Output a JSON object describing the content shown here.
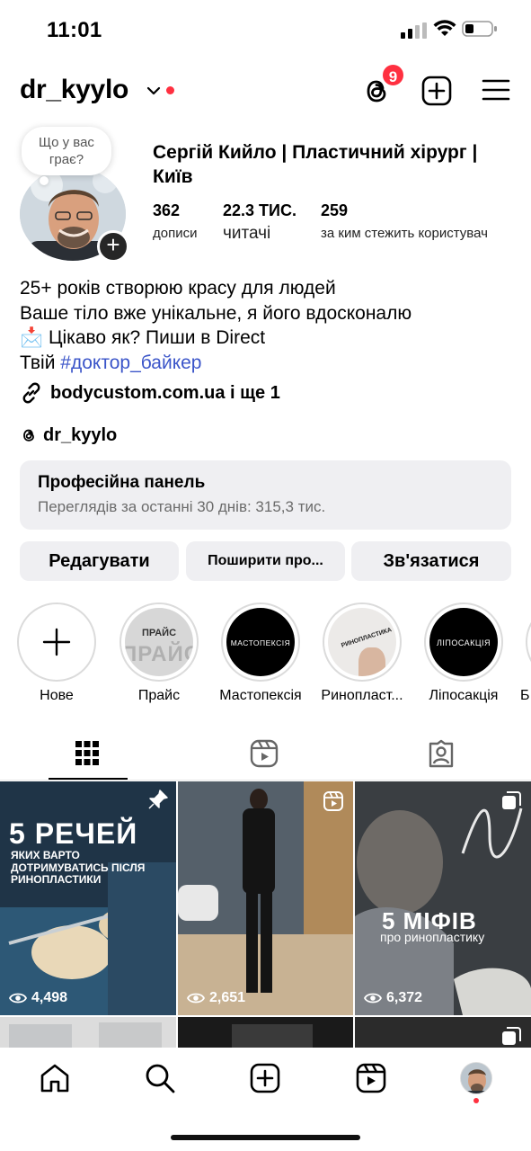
{
  "status_bar": {
    "time": "11:01"
  },
  "header": {
    "username": "dr_kyylo",
    "threads_badge": "9",
    "icons": [
      "chevron-down-icon",
      "threads-icon",
      "plus-square-icon",
      "menu-icon"
    ]
  },
  "profile": {
    "note": "Що у вас граєс?",
    "note_text": "Що у вас грає?",
    "full_name": "Сергій Кийло | Пластичний хірург | Київ",
    "stats": [
      {
        "value": "362",
        "label": "дописи"
      },
      {
        "value": "22.3 ТИС.",
        "label": "читачі"
      },
      {
        "value": "259",
        "label": "за ким стежить користувач"
      }
    ],
    "bio_lines": [
      "25+ років створюю красу для людей",
      "Ваше тіло вже унікальне,  я його вдосконалю",
      "📩 Цікаво як? Пиши в Direct",
      "Твій "
    ],
    "hashtag": "#доктор_байкер",
    "link": "bodycustom.com.ua і ще 1",
    "threads_handle": "dr_kyylo"
  },
  "pro_panel": {
    "title": "Професійна панель",
    "subtitle": "Переглядів за останні 30 днів: 315,3 тис."
  },
  "actions": {
    "edit": "Редагувати",
    "share": "Поширити про...",
    "contact": "Зв'язатися"
  },
  "highlights": [
    {
      "label": "Нове",
      "inner_text": ""
    },
    {
      "label": "Прайс",
      "inner_text": "ПРАЙС"
    },
    {
      "label": "Мастопексія",
      "inner_text": "МАСТОПЕКСІЯ"
    },
    {
      "label": "Ринопласт...",
      "inner_text": "РИНОПЛАСТИКА"
    },
    {
      "label": "Ліпосакція",
      "inner_text": "ЛІПОСАКЦІЯ"
    },
    {
      "label": "Б",
      "inner_text": ""
    }
  ],
  "grid": {
    "tiles": [
      {
        "views": "4,498",
        "headline": "5 РЕЧЕЙ",
        "sub": "ЯКИХ ВАРТО ДОТРИМУВАТИСЬ ПІСЛЯ РИНОПЛАСТИКИ",
        "corner_icon": "pin-icon"
      },
      {
        "views": "2,651",
        "headline": "",
        "sub": "",
        "corner_icon": "reels-icon"
      },
      {
        "views": "6,372",
        "headline": "5 МІФІВ",
        "sub": "про ринопластику",
        "corner_icon": "carousel-icon"
      }
    ]
  },
  "bottom_nav": [
    "home-icon",
    "search-icon",
    "create-icon",
    "reels-icon",
    "profile-avatar"
  ],
  "colors": {
    "accent_red": "#ff3040",
    "hashtag_blue": "#3b55c9",
    "panel_gray": "#efeff2"
  }
}
